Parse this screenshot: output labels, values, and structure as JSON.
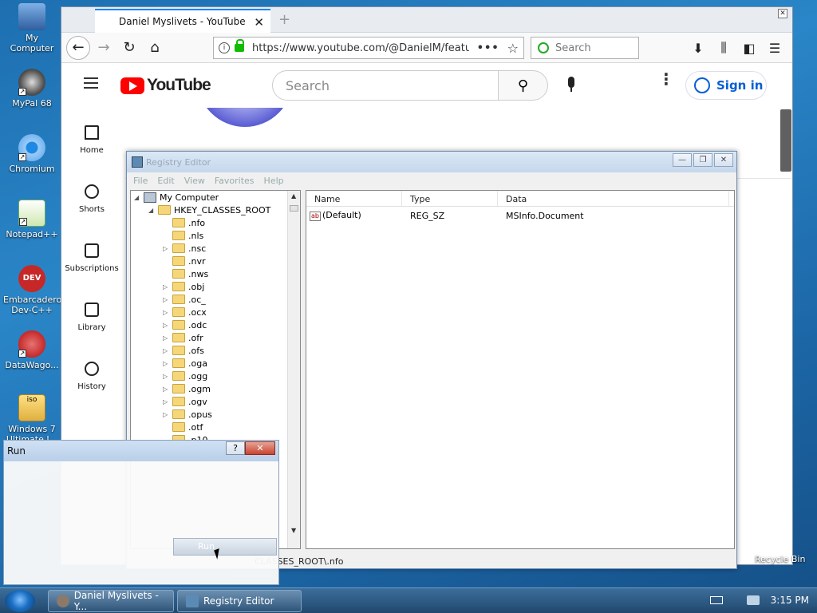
{
  "desktop": {
    "icons": [
      {
        "label": "My Computer"
      },
      {
        "label": "MyPal 68"
      },
      {
        "label": "Chromium"
      },
      {
        "label": "Notepad++"
      },
      {
        "label": "Embarcadero Dev-C++"
      },
      {
        "label": "DataWago..."
      },
      {
        "label": "Windows 7 Ultimate I..."
      }
    ],
    "recycle_bin": "Recycle Bin"
  },
  "browser": {
    "tab_title": "Daniel Myslivets - YouTube",
    "url": "https://www.youtube.com/@DanielM/featu",
    "search_placeholder": "Search",
    "youtube": {
      "logo_text": "YouTube",
      "search_placeholder": "Search",
      "sign_in": "Sign in",
      "sidebar": [
        {
          "label": "Home",
          "icon": "home-icon"
        },
        {
          "label": "Shorts",
          "icon": "shorts-icon"
        },
        {
          "label": "Subscriptions",
          "icon": "subscriptions-icon"
        },
        {
          "label": "Library",
          "icon": "library-icon"
        },
        {
          "label": "History",
          "icon": "history-icon"
        }
      ]
    }
  },
  "registry": {
    "title": "Registry Editor",
    "menu": [
      "File",
      "Edit",
      "View",
      "Favorites",
      "Help"
    ],
    "tree": {
      "root": "My Computer",
      "hive": "HKEY_CLASSES_ROOT",
      "keys": [
        ".nfo",
        ".nls",
        ".nsc",
        ".nvr",
        ".nws",
        ".obj",
        ".oc_",
        ".ocx",
        ".odc",
        ".ofr",
        ".ofs",
        ".oga",
        ".ogg",
        ".ogm",
        ".ogv",
        ".opus",
        ".otf",
        ".p10"
      ]
    },
    "columns": [
      "Name",
      "Type",
      "Data"
    ],
    "values": [
      {
        "name": "(Default)",
        "type": "REG_SZ",
        "data": "MSInfo.Document"
      }
    ],
    "status_path": "CLASSES_ROOT\\.nfo"
  },
  "run_dialog": {
    "title": "Run",
    "help": "?",
    "close": "✕",
    "run_button": "Run"
  },
  "taskbar": {
    "items": [
      {
        "label": "Daniel Myslivets - Y..."
      },
      {
        "label": "Registry Editor"
      }
    ],
    "clock": "3:15 PM"
  }
}
